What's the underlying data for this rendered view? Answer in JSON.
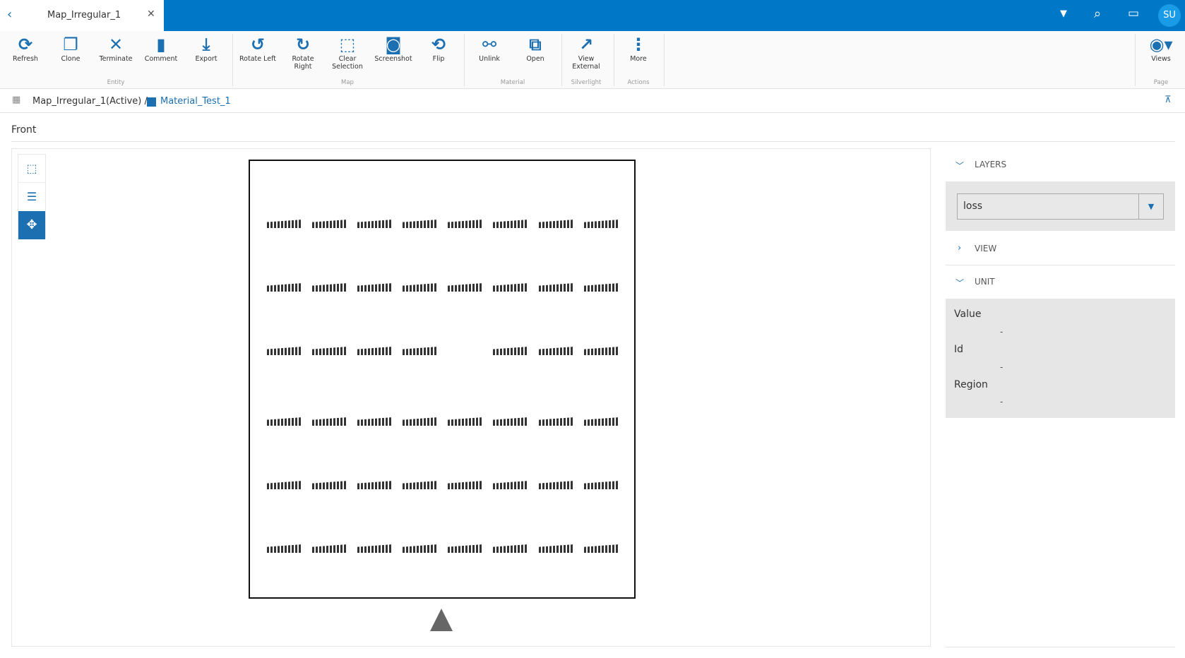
{
  "tab": {
    "title": "Map_Irregular_1"
  },
  "header": {
    "avatar": "SU"
  },
  "toolbar": {
    "buttons": [
      {
        "label": "Refresh",
        "icon": "⟳"
      },
      {
        "label": "Clone",
        "icon": "❐"
      },
      {
        "label": "Terminate",
        "icon": "✕"
      },
      {
        "label": "Comment",
        "icon": "▮"
      },
      {
        "label": "Export",
        "icon": "⤓"
      },
      {
        "label": "Rotate Left",
        "icon": "↺"
      },
      {
        "label": "Rotate Right",
        "icon": "↻"
      },
      {
        "label": "Clear Selection",
        "icon": "⬚"
      },
      {
        "label": "Screenshot",
        "icon": "◙"
      },
      {
        "label": "Flip",
        "icon": "⟲"
      },
      {
        "label": "Unlink",
        "icon": "⚯"
      },
      {
        "label": "Open",
        "icon": "⧉"
      },
      {
        "label": "View External",
        "icon": "↗"
      },
      {
        "label": "More",
        "icon": "⋮"
      },
      {
        "label": "Views",
        "icon": "◉▾"
      }
    ],
    "groups": [
      "Entity",
      "Map",
      "Material",
      "Silverlight",
      "Actions",
      "Page"
    ]
  },
  "breadcrumb": {
    "map": "Map_Irregular_1",
    "status": "(Active) /",
    "material": "Material_Test_1"
  },
  "view": {
    "title": "Front"
  },
  "panel": {
    "layers": {
      "title": "LAYERS",
      "selected": "loss"
    },
    "view": {
      "title": "VIEW"
    },
    "unit": {
      "title": "UNIT",
      "fields": [
        {
          "label": "Value",
          "value": "-"
        },
        {
          "label": "Id",
          "value": "-"
        },
        {
          "label": "Region",
          "value": "-"
        }
      ]
    }
  },
  "map": {
    "rows": 6,
    "cols": 8,
    "missing": [
      [
        2,
        4
      ]
    ]
  }
}
